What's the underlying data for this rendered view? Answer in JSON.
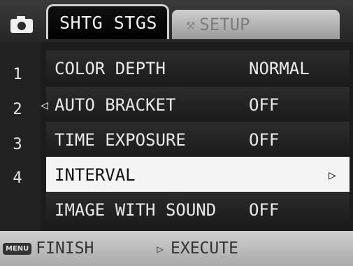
{
  "tabs": {
    "active": "SHTG STGS",
    "inactive": "SETUP",
    "inactive_icon": "tool-icon"
  },
  "pages": [
    "1",
    "2",
    "3",
    "4"
  ],
  "menu": {
    "items": [
      {
        "label": "COLOR DEPTH",
        "value": "NORMAL"
      },
      {
        "label": "AUTO BRACKET",
        "value": "OFF"
      },
      {
        "label": "TIME EXPOSURE",
        "value": "OFF"
      },
      {
        "label": "INTERVAL",
        "value": ""
      },
      {
        "label": "IMAGE WITH SOUND",
        "value": "OFF"
      }
    ],
    "selected_index": 3
  },
  "footer": {
    "menu_badge": "MENU",
    "finish": "FINISH",
    "execute": "EXECUTE"
  }
}
